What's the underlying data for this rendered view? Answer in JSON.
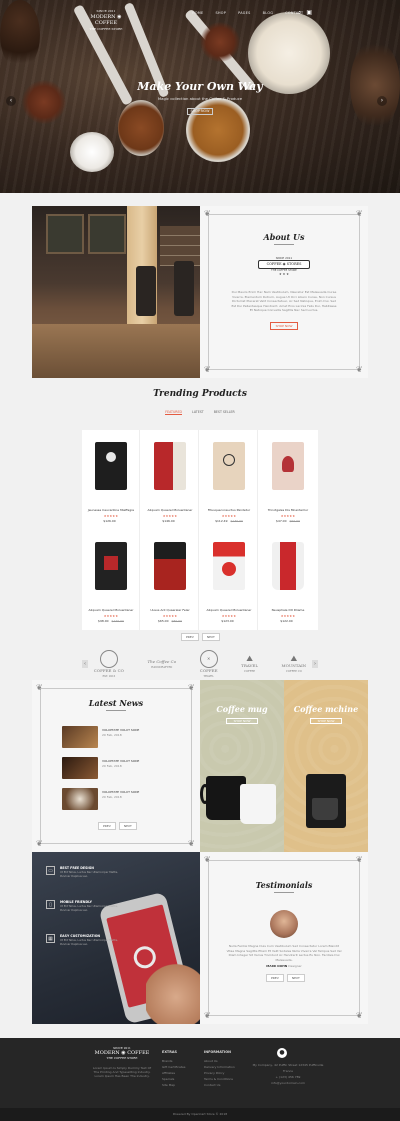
{
  "brand": {
    "top": "SINCE 2011",
    "name_left": "MODERN",
    "name_right": "COFFEE",
    "tagline": "THE COFFEE STORE"
  },
  "nav": {
    "items": [
      "HOME",
      "SHOP",
      "PAGES",
      "BLOG",
      "CONTACT"
    ]
  },
  "hero": {
    "title": "Make Your Own Way",
    "subtitle": "Magic collection about the Coffee & Produce",
    "button": "SHOP NOW"
  },
  "about": {
    "title": "About Us",
    "badge_top": "SINCE 2011",
    "badge_left": "COFFEE",
    "badge_right": "STORES",
    "badge_bottom": "THE COFFEE STORE",
    "body": "Dui Mauris Enim Hac Nam Vestibulum, Nascetur Est Malesuada Curae Viverra. Elementum Rutrum, Augue Ut Orci Libero Curae, Non Cursus Dictumst Placerat Velit Consectetuer, Ac Sed Natoque, Enim Dui. Sed Est Dui Pellentesque Hendrerit. Amet Eros Lacinia Felis Dui, Habitasse Et Natoque Convallis Sagittis Nec Sed Luctus.",
    "button": "SHOP NOW"
  },
  "trending": {
    "title": "Trending Products",
    "tabs": [
      "FEATURED",
      "LATEST",
      "BEST SELLER"
    ],
    "products": [
      {
        "name": "Jeunesse Caucantine Mieffagre",
        "stars": "★★★★★",
        "price": "$126.00",
        "old": ""
      },
      {
        "name": "Aliquam Quaerel Moluentaner",
        "stars": "★★★★★",
        "price": "$146.00",
        "old": ""
      },
      {
        "name": "Fitusqueconsuctus Pandetur",
        "stars": "★★★★★",
        "price": "$112.49",
        "old": "$130.00"
      },
      {
        "name": "Trinotgales Dis Mnenterilur",
        "stars": "★★★★★",
        "price": "$47.00",
        "old": "$50.00"
      },
      {
        "name": "Aliquam Quaerel Moluentaner",
        "stars": "★★★★★",
        "price": "$98.00",
        "old": "$120.00"
      },
      {
        "name": "Uusus Ant Quaeraler Feler",
        "stars": "★★★★★",
        "price": "$65.00",
        "old": "$80.00"
      },
      {
        "name": "Aliquam Quaerel Moluentaner",
        "stars": "★★★★★",
        "price": "$123.00",
        "old": ""
      },
      {
        "name": "Neusphale Dit Dliame",
        "stars": "★★★★★",
        "price": "$122.00",
        "old": ""
      }
    ],
    "prev": "PREV",
    "next": "NEXT"
  },
  "brands": [
    {
      "name": "COFFEE & CO",
      "sub": "EST. 2016"
    },
    {
      "name": "The Coffee Co",
      "sub": "HANDCRAFTED"
    },
    {
      "name": "COFFEE",
      "sub": "TRAVEL"
    },
    {
      "name": "TRAVEL",
      "sub": "COFFEE"
    },
    {
      "name": "MOUNTAIN",
      "sub": "COFFEE CO"
    }
  ],
  "news": {
    "title": "Latest News",
    "items": [
      {
        "title": "VOLUPTATE VOLUT SODE",
        "date": "20 Feb, 2018"
      },
      {
        "title": "VOLUPTATE VOLUT SODE",
        "date": "20 Feb, 2018"
      },
      {
        "title": "VOLUPTATE VOLUT SODE",
        "date": "20 Feb, 2018"
      }
    ],
    "prev": "PREV",
    "next": "NEXT"
  },
  "promos": [
    {
      "title": "Coffee mug",
      "button": "SHOP NOW"
    },
    {
      "title": "Coffee mchine",
      "button": "SHOP NOW"
    }
  ],
  "app": {
    "features": [
      {
        "title": "BEST FREE DESIGN",
        "desc": "Ut Elit Tellus, Luctus Nec Ullamcorper Mattis, Pulvinar Dapibus Leo."
      },
      {
        "title": "MOBILE FRIENDLY",
        "desc": "Ut Elit Tellus, Luctus Nec Ullamcorper Mattis, Pulvinar Dapibus Leo."
      },
      {
        "title": "EASY CUSTOMIZATION",
        "desc": "Ut Elit Tellus, Luctus Nec Ullamcorper Mattis, Pulvinar Dapibus Leo."
      }
    ]
  },
  "testimonials": {
    "title": "Testimonials",
    "quote": "Nulla Facilisi Magna Duis Cum Vestibulum Sed Consectetur Lorem Blandit Vitae Magna Sagittis Etiam Et Velit Sodales Nulla Viverra Vel Tempus Sed Vel Diam Integer Sit Varius Tincidunt Ac Hendrerit Lectus Eu Non. Facilisis Dui Malesuada.",
    "author": "MARK DOHN",
    "role": "Designer",
    "prev": "PREV",
    "next": "NEXT"
  },
  "footer": {
    "about": "Lorem Ipsum Is Simply Dummy Text Of The Printing And Typesetting Industry. Lorem Ipsum Has Been The Industry.",
    "extras_title": "EXTRAS",
    "extras": [
      "Brands",
      "Gift Certificates",
      "Affiliates",
      "Specials",
      "Site Map"
    ],
    "info_title": "INFORMATION",
    "info": [
      "About Us",
      "Delivery Information",
      "Privacy Policy",
      "Terms & Conditions",
      "Contact Us"
    ],
    "address": "My Company, 42 Puffin Street 12345 Puffinville France",
    "phone": "+ (123) 456 789",
    "email": "info@yourdomain.com",
    "copyright": "Powered By OpenCart Store © 2018"
  },
  "colors": {
    "accent": "#e45b41",
    "footer": "#262626",
    "mug_panel": "#c9c9ae",
    "machine_panel": "#dfc08a"
  }
}
